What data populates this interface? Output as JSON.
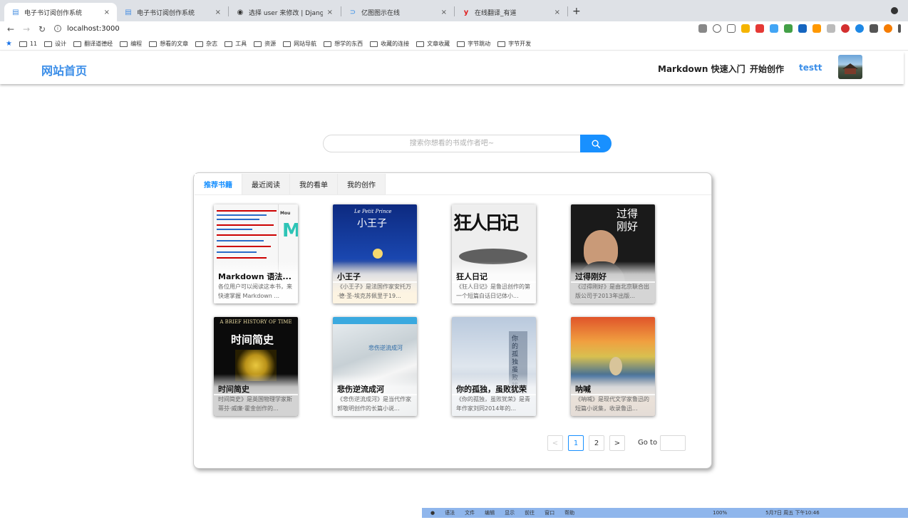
{
  "browser": {
    "tabs": [
      {
        "title": "电子书订阅创作系统",
        "active": true,
        "favicon": "doc-icon",
        "color": "#4a90e2"
      },
      {
        "title": "电子书订阅创作系统",
        "active": false,
        "favicon": "doc-icon",
        "color": "#4a90e2"
      },
      {
        "title": "选择 user 来修改 | Django 站点管",
        "active": false,
        "favicon": "globe-icon",
        "color": "#333333"
      },
      {
        "title": "亿图图示在线",
        "active": false,
        "favicon": "edraw-icon",
        "color": "#2f8ae8"
      },
      {
        "title": "在线翻译_有道",
        "active": false,
        "favicon": "youdao-icon",
        "color": "#e02020"
      }
    ],
    "tab_close": "×",
    "new_tab": "+",
    "url": "localhost:3000",
    "bookmarks": [
      "11",
      "设计",
      "翻译道德经",
      "编程",
      "想看的文章",
      "杂志",
      "工具",
      "资源",
      "网站导航",
      "想学的东西",
      "收藏的连接",
      "文章收藏",
      "字节跳动",
      "字节开发"
    ]
  },
  "header": {
    "logo": "网站首页",
    "nav": [
      "Markdown 快速入门",
      "开始创作"
    ],
    "username": "testt"
  },
  "search": {
    "placeholder": "搜索你想看的书或作者吧~"
  },
  "tabs": [
    "推荐书籍",
    "最近阅读",
    "我的看单",
    "我的创作"
  ],
  "books": [
    {
      "title": "Markdown 语法...",
      "desc": "各位用户可以阅读这本书，来快速掌握 Markdown ...",
      "cover_label": "Mou"
    },
    {
      "title": "小王子",
      "desc": "《小王子》是法国作家安托万·德·圣-埃克苏佩里于19...",
      "cover_label": "小王子",
      "cover_sub": "Le Petit Prince"
    },
    {
      "title": "狂人日记",
      "desc": "《狂人日记》是鲁迅创作的第一个短篇白话日记体小...",
      "cover_label": "狂人日记"
    },
    {
      "title": "过得刚好",
      "desc": "《过得刚好》是由北京联合出版公司于2013年出版...",
      "cover_label": "过得刚好"
    },
    {
      "title": "时间简史",
      "desc": "时间简史》是英国物理学家斯蒂芬·威廉·霍金创作的...",
      "cover_label": "时间简史",
      "cover_sub": "A BRIEF HISTORY OF TIME"
    },
    {
      "title": "悲伤逆流成河",
      "desc": "《悲伤逆流成河》是当代作家郭敬明创作的长篇小说...",
      "cover_label": "悲伤逆流成河"
    },
    {
      "title": "你的孤独，虽败犹荣",
      "desc": "《你的孤独，虽败犹荣》是青年作家刘同2014年的...",
      "cover_label": "你的孤独虽败犹荣"
    },
    {
      "title": "呐喊",
      "desc": "《呐喊》是现代文学家鲁迅的短篇小说集，收录鲁迅...",
      "cover_label": ""
    }
  ],
  "pagination": {
    "prev": "<",
    "pages": [
      "1",
      "2"
    ],
    "current": "1",
    "next": ">",
    "goto_label": "Go to"
  },
  "menubar": [
    "语法",
    "文件",
    "编辑",
    "显示",
    "前往",
    "窗口",
    "帮助",
    "100%",
    "5月7日 周五 下午10:46"
  ],
  "colors": {
    "accent": "#1890ff",
    "logo": "#3b8ee8"
  }
}
